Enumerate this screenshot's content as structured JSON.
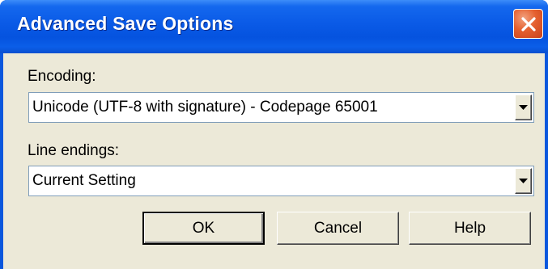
{
  "window": {
    "title": "Advanced Save Options"
  },
  "encoding": {
    "label": "Encoding:",
    "value": "Unicode (UTF-8 with signature) - Codepage 65001"
  },
  "line_endings": {
    "label": "Line endings:",
    "value": "Current Setting"
  },
  "buttons": {
    "ok": "OK",
    "cancel": "Cancel",
    "help": "Help"
  },
  "icons": {
    "close": "close-icon",
    "dropdown": "chevron-down-icon"
  },
  "colors": {
    "titlebar": "#0a5ae6",
    "close_button": "#e5602f",
    "dialog_background": "#ece9d8"
  }
}
